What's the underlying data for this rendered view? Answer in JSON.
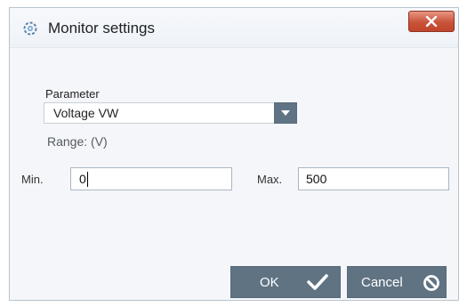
{
  "window": {
    "title": "Monitor settings",
    "title_icon": "gear-icon",
    "close_icon": "close-icon"
  },
  "form": {
    "parameter_label": "Parameter",
    "parameter_value": "Voltage VW",
    "dropdown_icon": "chevron-down-icon",
    "range_label": "Range: (V)",
    "min_label": "Min.",
    "min_value": "0",
    "max_label": "Max.",
    "max_value": "500"
  },
  "buttons": {
    "ok_label": "OK",
    "ok_icon": "checkmark-icon",
    "cancel_label": "Cancel",
    "cancel_icon": "prohibited-icon"
  },
  "colors": {
    "button_bg": "#607383",
    "close_button": "#c8533a",
    "window_bg": "#f4f6f9"
  }
}
